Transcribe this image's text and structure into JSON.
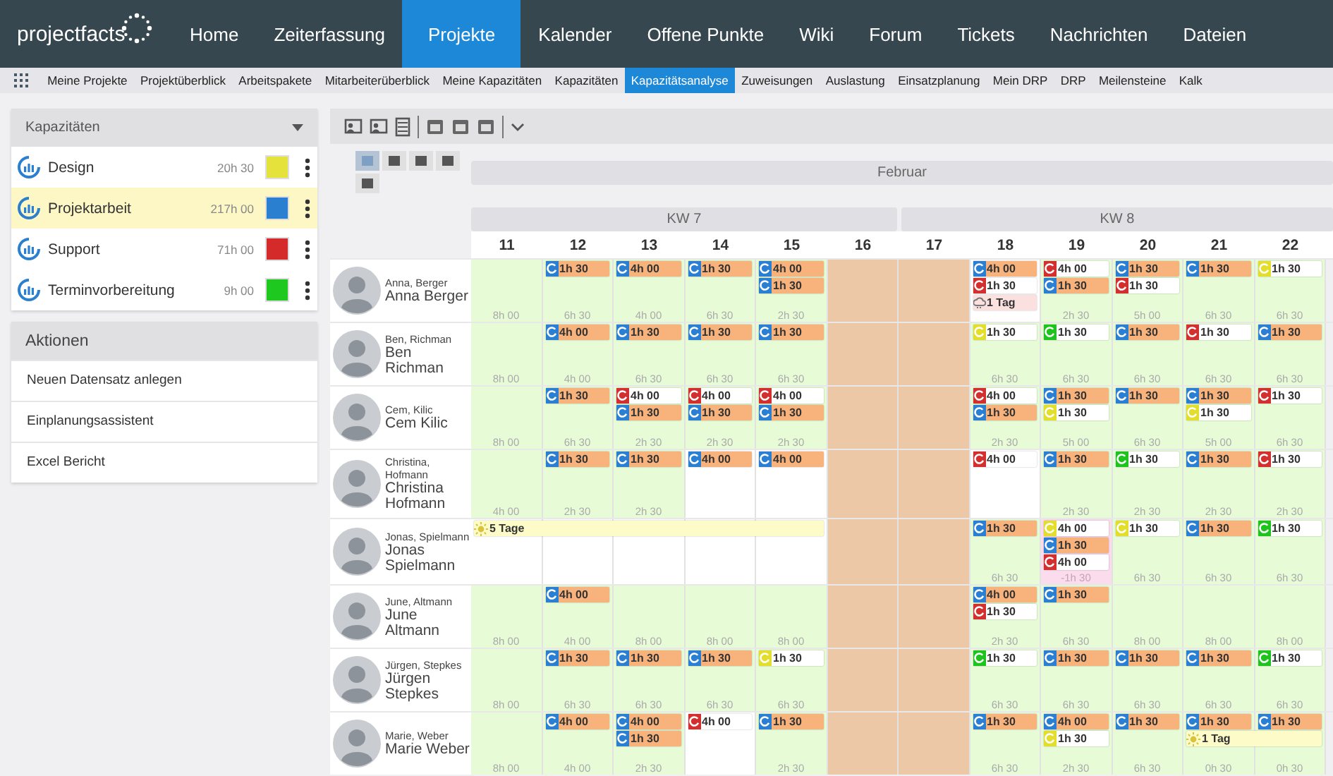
{
  "logo": {
    "text": "projectfacts"
  },
  "nav": [
    {
      "label": "Home",
      "selected": false
    },
    {
      "label": "Zeiterfassung",
      "selected": false
    },
    {
      "label": "Projekte",
      "selected": true
    },
    {
      "label": "Kalender",
      "selected": false
    },
    {
      "label": "Offene Punkte",
      "selected": false
    },
    {
      "label": "Wiki",
      "selected": false
    },
    {
      "label": "Forum",
      "selected": false
    },
    {
      "label": "Tickets",
      "selected": false
    },
    {
      "label": "Nachrichten",
      "selected": false
    },
    {
      "label": "Dateien",
      "selected": false
    }
  ],
  "subnav": [
    {
      "label": "Meine Projekte",
      "selected": false
    },
    {
      "label": "Projektüberblick",
      "selected": false
    },
    {
      "label": "Arbeitspakete",
      "selected": false
    },
    {
      "label": "Mitarbeiterüberblick",
      "selected": false
    },
    {
      "label": "Meine Kapazitäten",
      "selected": false
    },
    {
      "label": "Kapazitäten",
      "selected": false
    },
    {
      "label": "Kapazitätsanalyse",
      "selected": true
    },
    {
      "label": "Zuweisungen",
      "selected": false
    },
    {
      "label": "Auslastung",
      "selected": false
    },
    {
      "label": "Einsatzplanung",
      "selected": false
    },
    {
      "label": "Mein DRP",
      "selected": false
    },
    {
      "label": "DRP",
      "selected": false
    },
    {
      "label": "Meilensteine",
      "selected": false
    },
    {
      "label": "Kalk",
      "selected": false
    }
  ],
  "capacities": {
    "title": "Kapazitäten",
    "items": [
      {
        "name": "Design",
        "hours": "20h 30",
        "color": "#e6e23c",
        "selected": false
      },
      {
        "name": "Projektarbeit",
        "hours": "217h 00",
        "color": "#2a7fd0",
        "selected": true
      },
      {
        "name": "Support",
        "hours": "71h 00",
        "color": "#d42a2a",
        "selected": false
      },
      {
        "name": "Terminvorbereitung",
        "hours": "9h 00",
        "color": "#1ec81e",
        "selected": false
      }
    ]
  },
  "actions": {
    "title": "Aktionen",
    "items": [
      "Neuen Datensatz anlegen",
      "Einplanungsassistent",
      "Excel Bericht"
    ]
  },
  "view_buttons": [
    {
      "selected": true
    },
    {
      "selected": false
    },
    {
      "selected": false
    },
    {
      "selected": false
    },
    {
      "selected": false
    }
  ],
  "month": "Februar",
  "weeks": [
    {
      "label": "KW 7"
    },
    {
      "label": "KW 8"
    }
  ],
  "days": [
    "11",
    "12",
    "13",
    "14",
    "15",
    "16",
    "17",
    "18",
    "19",
    "20",
    "21",
    "22"
  ],
  "rows": [
    {
      "short": "Anna, Berger",
      "name": "Anna Berger",
      "cells": [
        {
          "kind": "free",
          "free": "8h 00"
        },
        {
          "kind": "free",
          "entries": [
            {
              "kind": "task",
              "color": "#2b7fd2",
              "highlighted": true,
              "text": "1h 30"
            }
          ],
          "free": "6h 30"
        },
        {
          "kind": "free",
          "entries": [
            {
              "kind": "task",
              "color": "#2b7fd2",
              "highlighted": true,
              "text": "4h 00"
            }
          ],
          "free": "4h 00"
        },
        {
          "kind": "free",
          "entries": [
            {
              "kind": "task",
              "color": "#2b7fd2",
              "highlighted": true,
              "text": "1h 30"
            }
          ],
          "free": "6h 30"
        },
        {
          "kind": "free",
          "entries": [
            {
              "kind": "task",
              "color": "#2b7fd2",
              "highlighted": true,
              "text": "4h 00"
            },
            {
              "kind": "task",
              "color": "#2b7fd2",
              "highlighted": true,
              "text": "1h 30"
            }
          ],
          "free": "2h 30"
        },
        {
          "kind": "weekend"
        },
        {
          "kind": "weekend"
        },
        {
          "kind": "full",
          "entries": [
            {
              "kind": "task",
              "color": "#2b7fd2",
              "highlighted": true,
              "text": "4h 00"
            },
            {
              "kind": "task",
              "color": "#d32f2f",
              "highlighted": false,
              "text": "1h 30"
            },
            {
              "kind": "absence",
              "text": "1 Tag"
            }
          ]
        },
        {
          "kind": "free",
          "entries": [
            {
              "kind": "task",
              "color": "#d32f2f",
              "highlighted": false,
              "text": "4h 00"
            },
            {
              "kind": "task",
              "color": "#2b7fd2",
              "highlighted": true,
              "text": "1h 30"
            }
          ],
          "free": "2h 30"
        },
        {
          "kind": "free",
          "entries": [
            {
              "kind": "task",
              "color": "#2b7fd2",
              "highlighted": true,
              "text": "1h 30"
            },
            {
              "kind": "task",
              "color": "#d32f2f",
              "highlighted": false,
              "text": "1h 30"
            }
          ],
          "free": "5h 00"
        },
        {
          "kind": "free",
          "entries": [
            {
              "kind": "task",
              "color": "#2b7fd2",
              "highlighted": true,
              "text": "1h 30"
            }
          ],
          "free": "6h 30"
        },
        {
          "kind": "free",
          "entries": [
            {
              "kind": "task",
              "color": "#e3dd2c",
              "highlighted": false,
              "text": "1h 30"
            }
          ],
          "free": "6h 30"
        }
      ]
    },
    {
      "short": "Ben, Richman",
      "name": "Ben Richman",
      "cells": [
        {
          "kind": "free",
          "free": "8h 00"
        },
        {
          "kind": "free",
          "entries": [
            {
              "kind": "task",
              "color": "#2b7fd2",
              "highlighted": true,
              "text": "4h 00"
            }
          ],
          "free": "4h 00"
        },
        {
          "kind": "free",
          "entries": [
            {
              "kind": "task",
              "color": "#2b7fd2",
              "highlighted": true,
              "text": "1h 30"
            }
          ],
          "free": "6h 30"
        },
        {
          "kind": "free",
          "entries": [
            {
              "kind": "task",
              "color": "#2b7fd2",
              "highlighted": true,
              "text": "1h 30"
            }
          ],
          "free": "6h 30"
        },
        {
          "kind": "free",
          "entries": [
            {
              "kind": "task",
              "color": "#2b7fd2",
              "highlighted": true,
              "text": "1h 30"
            }
          ],
          "free": "6h 30"
        },
        {
          "kind": "weekend"
        },
        {
          "kind": "weekend"
        },
        {
          "kind": "free",
          "entries": [
            {
              "kind": "task",
              "color": "#e3dd2c",
              "highlighted": false,
              "text": "1h 30"
            }
          ],
          "free": "6h 30"
        },
        {
          "kind": "free",
          "entries": [
            {
              "kind": "task",
              "color": "#1ec31e",
              "highlighted": false,
              "text": "1h 30"
            }
          ],
          "free": "6h 30"
        },
        {
          "kind": "free",
          "entries": [
            {
              "kind": "task",
              "color": "#2b7fd2",
              "highlighted": true,
              "text": "1h 30"
            }
          ],
          "free": "6h 30"
        },
        {
          "kind": "free",
          "entries": [
            {
              "kind": "task",
              "color": "#d32f2f",
              "highlighted": false,
              "text": "1h 30"
            }
          ],
          "free": "6h 30"
        },
        {
          "kind": "free",
          "entries": [
            {
              "kind": "task",
              "color": "#2b7fd2",
              "highlighted": true,
              "text": "1h 30"
            }
          ],
          "free": "6h 30"
        }
      ]
    },
    {
      "short": "Cem, Kilic",
      "name": "Cem Kilic",
      "cells": [
        {
          "kind": "free",
          "free": "8h 00"
        },
        {
          "kind": "free",
          "entries": [
            {
              "kind": "task",
              "color": "#2b7fd2",
              "highlighted": true,
              "text": "1h 30"
            }
          ],
          "free": "6h 30"
        },
        {
          "kind": "free",
          "entries": [
            {
              "kind": "task",
              "color": "#d32f2f",
              "highlighted": false,
              "text": "4h 00"
            },
            {
              "kind": "task",
              "color": "#2b7fd2",
              "highlighted": true,
              "text": "1h 30"
            }
          ],
          "free": "2h 30"
        },
        {
          "kind": "free",
          "entries": [
            {
              "kind": "task",
              "color": "#d32f2f",
              "highlighted": false,
              "text": "4h 00"
            },
            {
              "kind": "task",
              "color": "#2b7fd2",
              "highlighted": true,
              "text": "1h 30"
            }
          ],
          "free": "2h 30"
        },
        {
          "kind": "free",
          "entries": [
            {
              "kind": "task",
              "color": "#d32f2f",
              "highlighted": false,
              "text": "4h 00"
            },
            {
              "kind": "task",
              "color": "#2b7fd2",
              "highlighted": true,
              "text": "1h 30"
            }
          ],
          "free": "2h 30"
        },
        {
          "kind": "weekend"
        },
        {
          "kind": "weekend"
        },
        {
          "kind": "free",
          "entries": [
            {
              "kind": "task",
              "color": "#d32f2f",
              "highlighted": false,
              "text": "4h 00"
            },
            {
              "kind": "task",
              "color": "#2b7fd2",
              "highlighted": true,
              "text": "1h 30"
            }
          ],
          "free": "2h 30"
        },
        {
          "kind": "free",
          "entries": [
            {
              "kind": "task",
              "color": "#2b7fd2",
              "highlighted": true,
              "text": "1h 30"
            },
            {
              "kind": "task",
              "color": "#e3dd2c",
              "highlighted": false,
              "text": "1h 30"
            }
          ],
          "free": "5h 00"
        },
        {
          "kind": "free",
          "entries": [
            {
              "kind": "task",
              "color": "#2b7fd2",
              "highlighted": true,
              "text": "1h 30"
            }
          ],
          "free": "6h 30"
        },
        {
          "kind": "free",
          "entries": [
            {
              "kind": "task",
              "color": "#2b7fd2",
              "highlighted": true,
              "text": "1h 30"
            },
            {
              "kind": "task",
              "color": "#e3dd2c",
              "highlighted": false,
              "text": "1h 30"
            }
          ],
          "free": "5h 00"
        },
        {
          "kind": "free",
          "entries": [
            {
              "kind": "task",
              "color": "#d32f2f",
              "highlighted": false,
              "text": "1h 30"
            }
          ],
          "free": "6h 30"
        }
      ]
    },
    {
      "short": "Christina, Hofmann",
      "name": "Christina Hofmann",
      "cells": [
        {
          "kind": "free",
          "free": "4h 00"
        },
        {
          "kind": "free",
          "entries": [
            {
              "kind": "task",
              "color": "#2b7fd2",
              "highlighted": true,
              "text": "1h 30"
            }
          ],
          "free": "2h 30"
        },
        {
          "kind": "free",
          "entries": [
            {
              "kind": "task",
              "color": "#2b7fd2",
              "highlighted": true,
              "text": "1h 30"
            }
          ],
          "free": "2h 30"
        },
        {
          "kind": "full",
          "entries": [
            {
              "kind": "task",
              "color": "#2b7fd2",
              "highlighted": true,
              "text": "4h 00"
            }
          ]
        },
        {
          "kind": "full",
          "entries": [
            {
              "kind": "task",
              "color": "#2b7fd2",
              "highlighted": true,
              "text": "4h 00"
            }
          ]
        },
        {
          "kind": "weekend"
        },
        {
          "kind": "weekend"
        },
        {
          "kind": "full",
          "entries": [
            {
              "kind": "task",
              "color": "#d32f2f",
              "highlighted": false,
              "text": "4h 00"
            }
          ]
        },
        {
          "kind": "free",
          "entries": [
            {
              "kind": "task",
              "color": "#2b7fd2",
              "highlighted": true,
              "text": "1h 30"
            }
          ],
          "free": "2h 30"
        },
        {
          "kind": "free",
          "entries": [
            {
              "kind": "task",
              "color": "#1ec31e",
              "highlighted": false,
              "text": "1h 30"
            }
          ],
          "free": "2h 30"
        },
        {
          "kind": "free",
          "entries": [
            {
              "kind": "task",
              "color": "#2b7fd2",
              "highlighted": true,
              "text": "1h 30"
            }
          ],
          "free": "2h 30"
        },
        {
          "kind": "free",
          "entries": [
            {
              "kind": "task",
              "color": "#d32f2f",
              "highlighted": false,
              "text": "1h 30"
            }
          ],
          "free": "2h 30"
        }
      ]
    },
    {
      "short": "Jonas, Spielmann",
      "name": "Jonas Spielmann",
      "cells": [
        {
          "kind": "full",
          "vacation": true,
          "entries": [
            {
              "kind": "vacation",
              "text": "5 Tage"
            }
          ]
        },
        {
          "kind": "full",
          "vacation": true
        },
        {
          "kind": "full",
          "vacation": true
        },
        {
          "kind": "full",
          "vacation": true
        },
        {
          "kind": "full",
          "vacation": true
        },
        {
          "kind": "weekend"
        },
        {
          "kind": "weekend"
        },
        {
          "kind": "free",
          "entries": [
            {
              "kind": "task",
              "color": "#2b7fd2",
              "highlighted": true,
              "text": "1h 30"
            }
          ],
          "free": "6h 30"
        },
        {
          "kind": "over",
          "entries": [
            {
              "kind": "task",
              "color": "#e3dd2c",
              "highlighted": false,
              "text": "4h 00"
            },
            {
              "kind": "task",
              "color": "#2b7fd2",
              "highlighted": true,
              "text": "1h 30"
            },
            {
              "kind": "task",
              "color": "#d32f2f",
              "highlighted": false,
              "text": "4h 00"
            }
          ],
          "free": "-1h 30"
        },
        {
          "kind": "free",
          "entries": [
            {
              "kind": "task",
              "color": "#e3dd2c",
              "highlighted": false,
              "text": "1h 30"
            }
          ],
          "free": "6h 30"
        },
        {
          "kind": "free",
          "entries": [
            {
              "kind": "task",
              "color": "#2b7fd2",
              "highlighted": true,
              "text": "1h 30"
            }
          ],
          "free": "6h 30"
        },
        {
          "kind": "free",
          "entries": [
            {
              "kind": "task",
              "color": "#1ec31e",
              "highlighted": false,
              "text": "1h 30"
            }
          ],
          "free": "6h 30"
        }
      ]
    },
    {
      "short": "June, Altmann",
      "name": "June Altmann",
      "cells": [
        {
          "kind": "free",
          "free": "8h 00"
        },
        {
          "kind": "free",
          "entries": [
            {
              "kind": "task",
              "color": "#2b7fd2",
              "highlighted": true,
              "text": "4h 00"
            }
          ],
          "free": "4h 00"
        },
        {
          "kind": "free",
          "free": "8h 00"
        },
        {
          "kind": "free",
          "free": "8h 00"
        },
        {
          "kind": "free",
          "free": "8h 00"
        },
        {
          "kind": "weekend"
        },
        {
          "kind": "weekend"
        },
        {
          "kind": "free",
          "entries": [
            {
              "kind": "task",
              "color": "#2b7fd2",
              "highlighted": true,
              "text": "4h 00"
            },
            {
              "kind": "task",
              "color": "#d32f2f",
              "highlighted": false,
              "text": "1h 30"
            }
          ],
          "free": "2h 30"
        },
        {
          "kind": "free",
          "entries": [
            {
              "kind": "task",
              "color": "#2b7fd2",
              "highlighted": true,
              "text": "1h 30"
            }
          ],
          "free": "6h 30"
        },
        {
          "kind": "free",
          "free": "8h 00"
        },
        {
          "kind": "free",
          "free": "8h 00"
        },
        {
          "kind": "free",
          "free": "8h 00"
        }
      ]
    },
    {
      "short": "Jürgen, Stepkes",
      "name": "Jürgen Stepkes",
      "cells": [
        {
          "kind": "free",
          "free": "8h 00"
        },
        {
          "kind": "free",
          "entries": [
            {
              "kind": "task",
              "color": "#2b7fd2",
              "highlighted": true,
              "text": "1h 30"
            }
          ],
          "free": "6h 30"
        },
        {
          "kind": "free",
          "entries": [
            {
              "kind": "task",
              "color": "#2b7fd2",
              "highlighted": true,
              "text": "1h 30"
            }
          ],
          "free": "6h 30"
        },
        {
          "kind": "free",
          "entries": [
            {
              "kind": "task",
              "color": "#2b7fd2",
              "highlighted": true,
              "text": "1h 30"
            }
          ],
          "free": "6h 30"
        },
        {
          "kind": "free",
          "entries": [
            {
              "kind": "task",
              "color": "#e3dd2c",
              "highlighted": false,
              "text": "1h 30"
            }
          ],
          "free": "6h 30"
        },
        {
          "kind": "weekend"
        },
        {
          "kind": "weekend"
        },
        {
          "kind": "free",
          "entries": [
            {
              "kind": "task",
              "color": "#1ec31e",
              "highlighted": false,
              "text": "1h 30"
            }
          ],
          "free": "6h 30"
        },
        {
          "kind": "free",
          "entries": [
            {
              "kind": "task",
              "color": "#2b7fd2",
              "highlighted": true,
              "text": "1h 30"
            }
          ],
          "free": "6h 30"
        },
        {
          "kind": "free",
          "entries": [
            {
              "kind": "task",
              "color": "#2b7fd2",
              "highlighted": true,
              "text": "1h 30"
            }
          ],
          "free": "6h 30"
        },
        {
          "kind": "free",
          "entries": [
            {
              "kind": "task",
              "color": "#2b7fd2",
              "highlighted": true,
              "text": "1h 30"
            }
          ],
          "free": "6h 30"
        },
        {
          "kind": "free",
          "entries": [
            {
              "kind": "task",
              "color": "#1ec31e",
              "highlighted": false,
              "text": "1h 30"
            }
          ],
          "free": "6h 30"
        }
      ]
    },
    {
      "short": "Marie, Weber",
      "name": "Marie Weber",
      "cells": [
        {
          "kind": "free",
          "free": "8h 00"
        },
        {
          "kind": "free",
          "entries": [
            {
              "kind": "task",
              "color": "#2b7fd2",
              "highlighted": true,
              "text": "4h 00"
            }
          ],
          "free": "4h 00"
        },
        {
          "kind": "free",
          "entries": [
            {
              "kind": "task",
              "color": "#2b7fd2",
              "highlighted": true,
              "text": "4h 00"
            },
            {
              "kind": "task",
              "color": "#2b7fd2",
              "highlighted": true,
              "text": "1h 30"
            }
          ],
          "free": "2h 30"
        },
        {
          "kind": "full",
          "entries": [
            {
              "kind": "task",
              "color": "#d32f2f",
              "highlighted": false,
              "text": "4h 00"
            }
          ]
        },
        {
          "kind": "free",
          "entries": [
            {
              "kind": "task",
              "color": "#2b7fd2",
              "highlighted": true,
              "text": "1h 30"
            }
          ],
          "free": "2h 30"
        },
        {
          "kind": "weekend"
        },
        {
          "kind": "weekend"
        },
        {
          "kind": "free",
          "entries": [
            {
              "kind": "task",
              "color": "#2b7fd2",
              "highlighted": true,
              "text": "1h 30"
            }
          ],
          "free": "6h 30"
        },
        {
          "kind": "free",
          "entries": [
            {
              "kind": "task",
              "color": "#2b7fd2",
              "highlighted": true,
              "text": "4h 00"
            },
            {
              "kind": "task",
              "color": "#e3dd2c",
              "highlighted": false,
              "text": "1h 30"
            }
          ],
          "free": "2h 30"
        },
        {
          "kind": "free",
          "entries": [
            {
              "kind": "task",
              "color": "#2b7fd2",
              "highlighted": true,
              "text": "1h 30"
            }
          ],
          "free": "6h 30"
        },
        {
          "kind": "free",
          "vacation": true,
          "entries": [
            {
              "kind": "task",
              "color": "#2b7fd2",
              "highlighted": true,
              "text": "1h 30"
            },
            {
              "kind": "vacation",
              "text": "1 Tag"
            }
          ],
          "free": "0h 30"
        },
        {
          "kind": "free",
          "vacation": true,
          "entries": [
            {
              "kind": "task",
              "color": "#2b7fd2",
              "highlighted": true,
              "text": "1h 30"
            }
          ],
          "free": "0h 30"
        }
      ]
    }
  ]
}
